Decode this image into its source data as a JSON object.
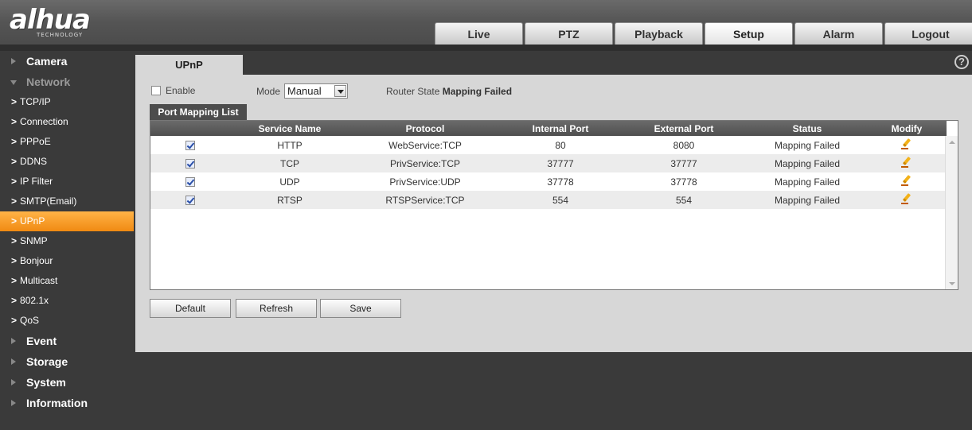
{
  "brand": {
    "logo_text": "alhua",
    "logo_sub": "TECHNOLOGY"
  },
  "top_tabs": [
    {
      "label": "Live"
    },
    {
      "label": "PTZ"
    },
    {
      "label": "Playback"
    },
    {
      "label": "Setup",
      "active": true
    },
    {
      "label": "Alarm"
    },
    {
      "label": "Logout"
    }
  ],
  "sidebar": {
    "camera": "Camera",
    "network": "Network",
    "network_items": [
      "TCP/IP",
      "Connection",
      "PPPoE",
      "DDNS",
      "IP Filter",
      "SMTP(Email)",
      "UPnP",
      "SNMP",
      "Bonjour",
      "Multicast",
      "802.1x",
      "QoS"
    ],
    "active_item": "UPnP",
    "event": "Event",
    "storage": "Storage",
    "system": "System",
    "information": "Information"
  },
  "page": {
    "tab_label": "UPnP",
    "help_icon": "help-icon",
    "enable_label": "Enable",
    "enable_checked": false,
    "mode_label": "Mode",
    "mode_value": "Manual",
    "router_state_label": "Router State",
    "router_state_value": "Mapping Failed",
    "port_mapping_tab": "Port Mapping List"
  },
  "table": {
    "headers": [
      "",
      "Service Name",
      "Protocol",
      "Internal Port",
      "External Port",
      "Status",
      "Modify"
    ],
    "rows": [
      {
        "checked": true,
        "service": "HTTP",
        "protocol": "WebService:TCP",
        "internal": "80",
        "external": "8080",
        "status": "Mapping Failed"
      },
      {
        "checked": true,
        "service": "TCP",
        "protocol": "PrivService:TCP",
        "internal": "37777",
        "external": "37777",
        "status": "Mapping Failed"
      },
      {
        "checked": true,
        "service": "UDP",
        "protocol": "PrivService:UDP",
        "internal": "37778",
        "external": "37778",
        "status": "Mapping Failed"
      },
      {
        "checked": true,
        "service": "RTSP",
        "protocol": "RTSPService:TCP",
        "internal": "554",
        "external": "554",
        "status": "Mapping Failed"
      }
    ]
  },
  "buttons": {
    "default": "Default",
    "refresh": "Refresh",
    "save": "Save"
  },
  "colors": {
    "accent": "#f08a12",
    "header_bg": "#555555",
    "panel_bg": "#d7d7d7"
  }
}
